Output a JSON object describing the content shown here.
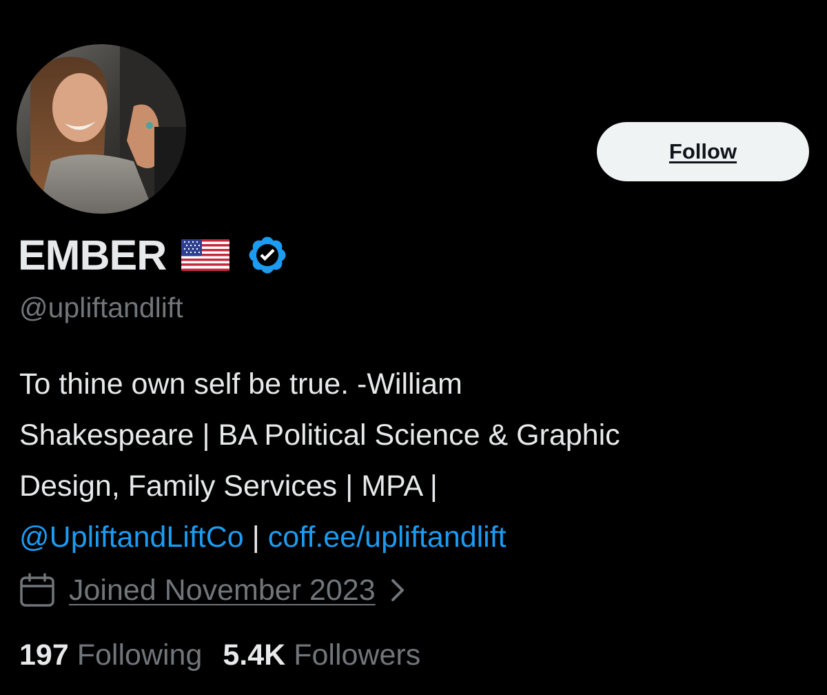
{
  "profile": {
    "display_name": "EMBER",
    "flag_emoji": "us-flag-icon",
    "verified_icon": "verified-badge-icon",
    "handle": "@upliftandlift",
    "follow_label": "Follow",
    "bio": {
      "line1": "To thine own self be true. -William",
      "line2": "Shakespeare | BA Political Science & Graphic",
      "line3": "Design, Family Services | MPA |",
      "link_account": "@UpliftandLiftCo",
      "separator": " | ",
      "link_url": "coff.ee/upliftandlift"
    },
    "joined": "Joined November 2023",
    "following_count": "197",
    "following_label": "Following",
    "followers_count": "5.4K",
    "followers_label": "Followers"
  },
  "colors": {
    "background": "#000000",
    "text_primary": "#e7e9ea",
    "text_secondary": "#71767b",
    "link": "#1d9bf0",
    "verified": "#1d9bf0",
    "follow_button_bg": "#eff3f4"
  }
}
